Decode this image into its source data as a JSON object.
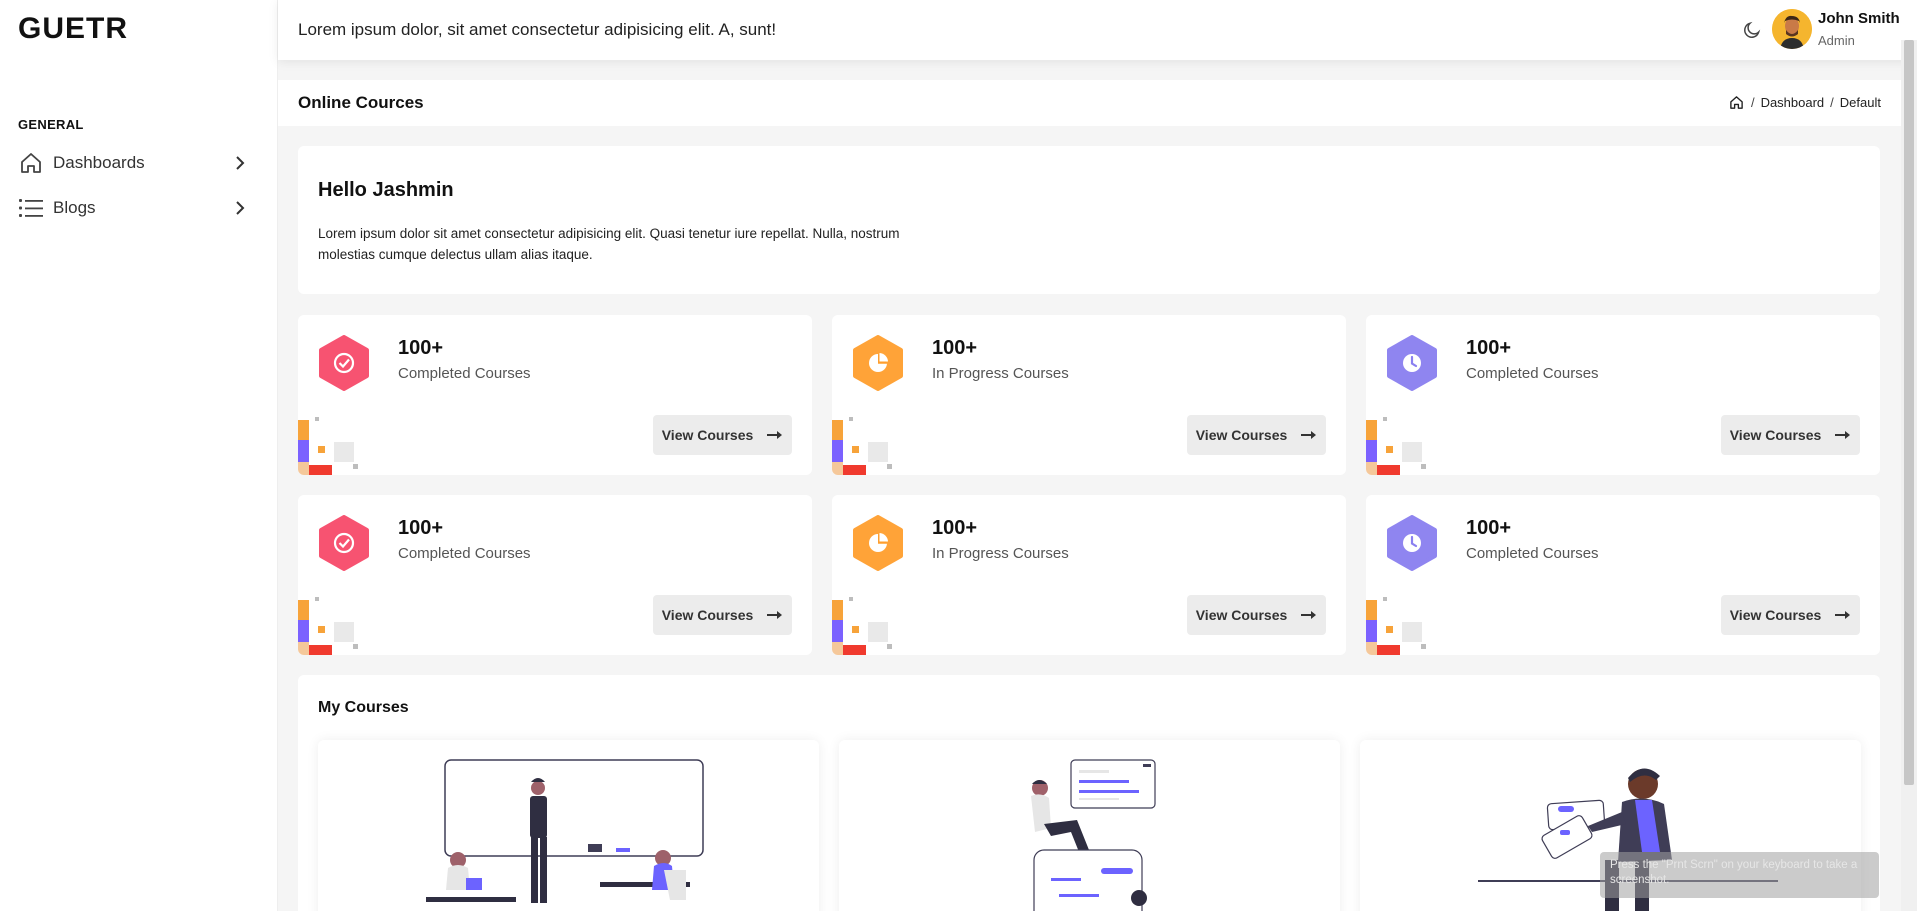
{
  "app": {
    "logo": "GUETR"
  },
  "sidebar": {
    "section": "GENERAL",
    "items": [
      {
        "label": "Dashboards",
        "icon": "home-icon"
      },
      {
        "label": "Blogs",
        "icon": "list-icon"
      }
    ]
  },
  "header": {
    "text": "Lorem ipsum dolor, sit amet consectetur adipisicing elit. A, sunt!",
    "user": {
      "name": "John Smith",
      "role": "Admin"
    }
  },
  "page": {
    "title": "Online Cources",
    "breadcrumb": [
      "Dashboard",
      "Default"
    ]
  },
  "hello": {
    "title": "Hello Jashmin",
    "body": "Lorem ipsum dolor sit amet consectetur adipisicing elit. Quasi tenetur iure repellat. Nulla, nostrum molestias cumque delectus ullam alias itaque."
  },
  "stats": [
    {
      "value": "100+",
      "label": "Completed Courses",
      "button": "View Courses",
      "color": "#f74a6a",
      "icon": "check-circle-icon"
    },
    {
      "value": "100+",
      "label": "In Progress Courses",
      "button": "View Courses",
      "color": "#ff9f2e",
      "icon": "pie-chart-icon"
    },
    {
      "value": "100+",
      "label": "Completed Courses",
      "button": "View Courses",
      "color": "#8a7ff0",
      "icon": "clock-icon"
    },
    {
      "value": "100+",
      "label": "Completed Courses",
      "button": "View Courses",
      "color": "#f74a6a",
      "icon": "check-circle-icon"
    },
    {
      "value": "100+",
      "label": "In Progress Courses",
      "button": "View Courses",
      "color": "#ff9f2e",
      "icon": "pie-chart-icon"
    },
    {
      "value": "100+",
      "label": "Completed Courses",
      "button": "View Courses",
      "color": "#8a7ff0",
      "icon": "clock-icon"
    }
  ],
  "courses": {
    "title": "My Courses"
  },
  "toast": {
    "text": "Press the \"Prnt Scrn\" on your keyboard to take a screenshot."
  },
  "colors": {
    "accent": "#6c63ff",
    "pink": "#f74a6a",
    "orange": "#ff9f2e",
    "purple": "#8a7ff0"
  }
}
